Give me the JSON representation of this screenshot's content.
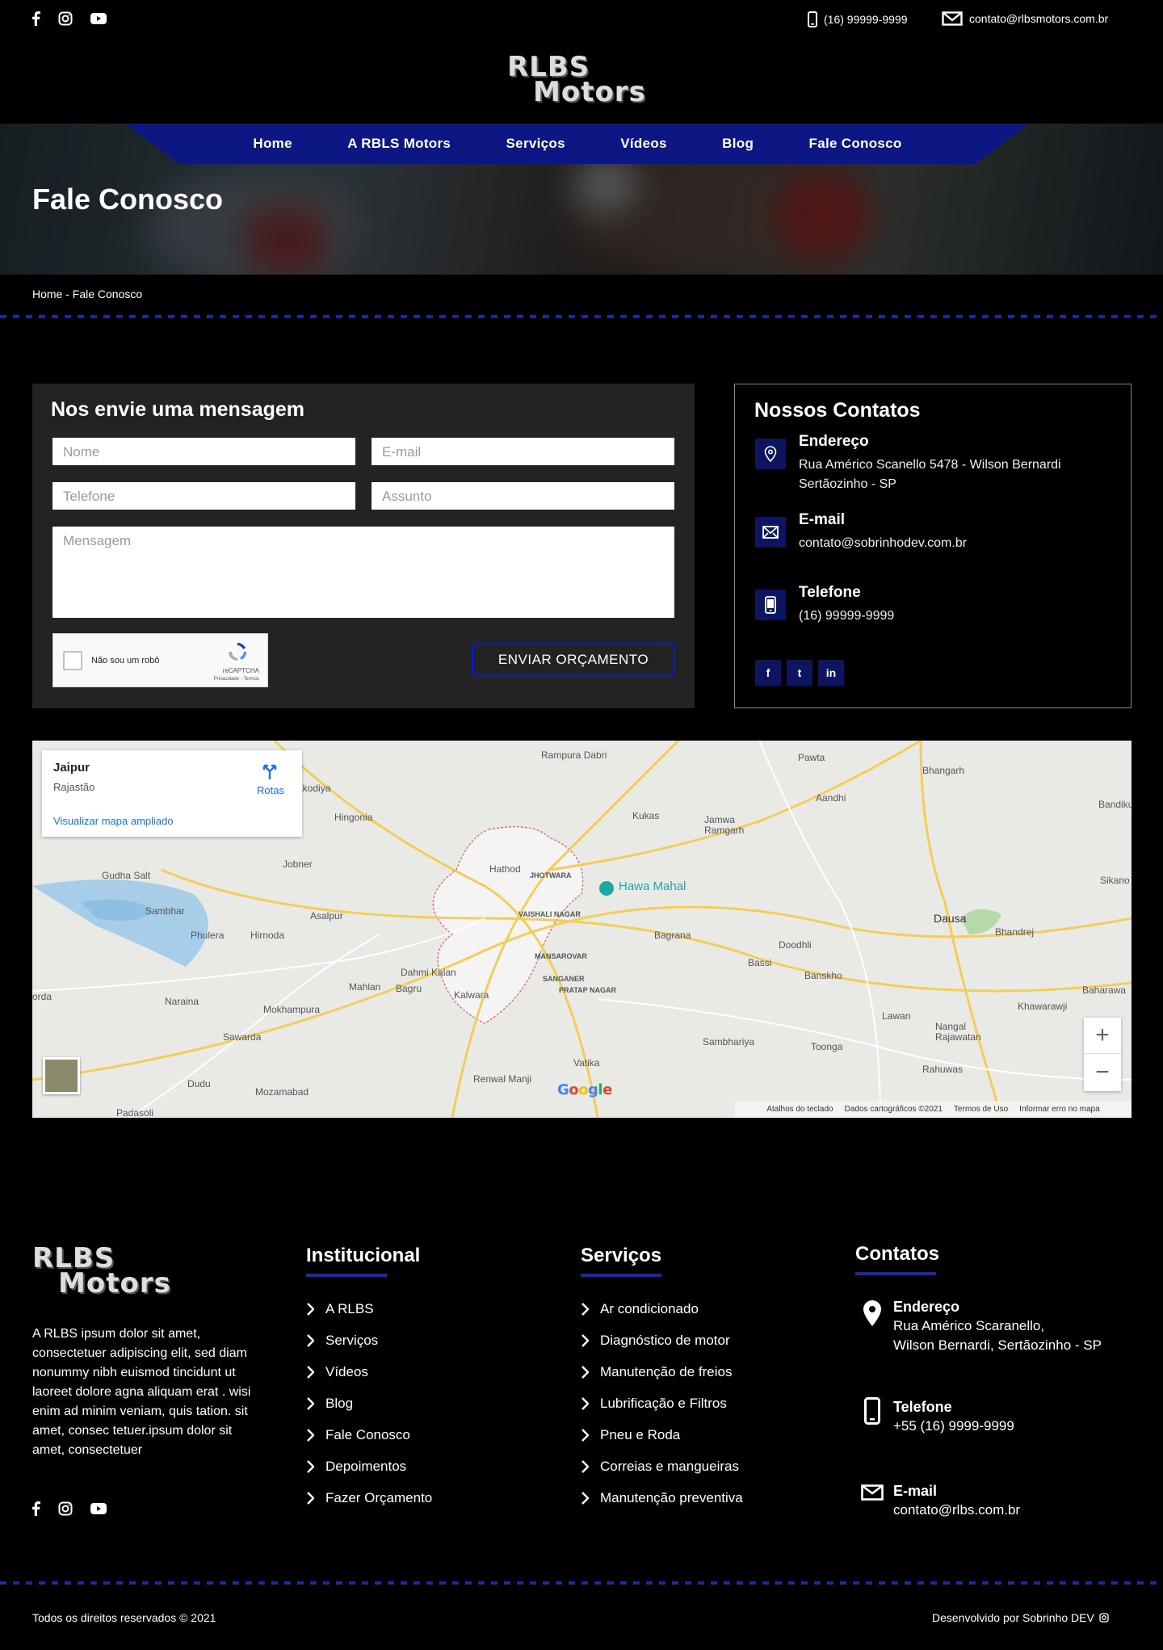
{
  "topbar": {
    "social": [
      "facebook-icon",
      "instagram-icon",
      "youtube-icon"
    ],
    "phone": "(16) 99999-9999",
    "email": "contato@rlbsmotors.com.br"
  },
  "logo": {
    "line1": "RLBS",
    "line2": "Motors"
  },
  "nav": [
    "Home",
    "A  RBLS  Motors",
    "Serviços",
    "Vídeos",
    "Blog",
    "Fale  Conosco"
  ],
  "hero": {
    "title": "Fale Conosco"
  },
  "breadcrumb": "Home - Fale Conosco",
  "form": {
    "title": "Nos envie uma mensagem",
    "name_placeholder": "Nome",
    "email_placeholder": "E-mail",
    "phone_placeholder": "Telefone",
    "subject_placeholder": "Assunto",
    "message_placeholder": "Mensagem",
    "captcha_label": "Não sou um robô",
    "captcha_brand": "reCAPTCHA",
    "captcha_links": "Privacidade - Termos",
    "submit": "ENVIAR ORÇAMENTO"
  },
  "contacts": {
    "title": "Nossos Contatos",
    "address_title": "Endereço",
    "address_line1": "Rua Américo Scanello 5478 - Wilson Bernardi",
    "address_line2": "Sertãozinho - SP",
    "email_title": "E-mail",
    "email": "contato@sobrinhodev.com.br",
    "phone_title": "Telefone",
    "phone": "(16) 99999-9999",
    "social": [
      "f",
      "t",
      "in"
    ]
  },
  "map": {
    "card_title": "Jaipur",
    "card_sub": "Rajastão",
    "card_link": "Visualizar mapa ampliado",
    "directions": "Rotas",
    "places": [
      "Rampura Dabri",
      "Pawta",
      "Bhangarh",
      "Bandiku",
      "Hingonia",
      "Kukas",
      "Jamwa Ramgarh",
      "Aandhi",
      "Gudha Salt",
      "Jobner",
      "Hathod",
      "Hawa Mahal",
      "Sikano",
      "Sambhar",
      "JHOTWARA",
      "Dausa",
      "Bhandrej",
      "Phulera",
      "Hirnoda",
      "Asalpur",
      "VAISHALI NAGAR",
      "Bagrana",
      "Doodhli",
      "Dahmi Kalan",
      "MANSAROVAR",
      "Bassi",
      "Banskho",
      "Mahlan",
      "Bagru",
      "Kalwara",
      "SANGANER",
      "PRATAP NAGAR",
      "Baharawa",
      "Naraina",
      "Mokhampura",
      "Khawarawji",
      "Lawan",
      "Sawarda",
      "Nangal Rajawatan",
      "Sambhariya",
      "Toonga",
      "Renwal Manji",
      "Vatika",
      "Rahuwas",
      "Dudu",
      "Mozamabad",
      "Padasoli",
      "orda",
      "akodiya"
    ],
    "footer": [
      "Atalhos do teclado",
      "Dados cartográficos ©2021",
      "Termos de Uso",
      "Informar erro no mapa"
    ],
    "zoom_in": "+",
    "zoom_out": "−"
  },
  "footer": {
    "about": "A RLBS ipsum dolor sit amet, consectetuer adipiscing elit, sed diam nonummy nibh euismod tincidunt ut laoreet dolore agna aliquam erat . wisi enim ad minim veniam, quis tation. sit amet, consec tetuer.ipsum dolor sit amet, consectetuer",
    "institucional_title": "Institucional",
    "institucional": [
      "A RLBS",
      "Serviços",
      "Vídeos",
      "Blog",
      "Fale Conosco",
      "Depoimentos",
      "Fazer Orçamento"
    ],
    "servicos_title": "Serviços",
    "servicos": [
      "Ar condicionado",
      "Diagnóstico de motor",
      "Manutenção de freios",
      "Lubrificação e Filtros",
      "Pneu e Roda",
      "Correias e mangueiras",
      "Manutenção preventiva"
    ],
    "contatos_title": "Contatos",
    "addr_title": "Endereço",
    "addr_line1": "Rua Américo Scaranello,",
    "addr_line2": "Wilson Bernardi, Sertãozinho - SP",
    "tel_title": "Telefone",
    "tel": "+55 (16) 9999-9999",
    "mail_title": "E-mail",
    "mail": "contato@rlbs.com.br",
    "copyright": "Todos os direitos reservados © 2021",
    "developed": "Desenvolvido por Sobrinho DEV"
  }
}
